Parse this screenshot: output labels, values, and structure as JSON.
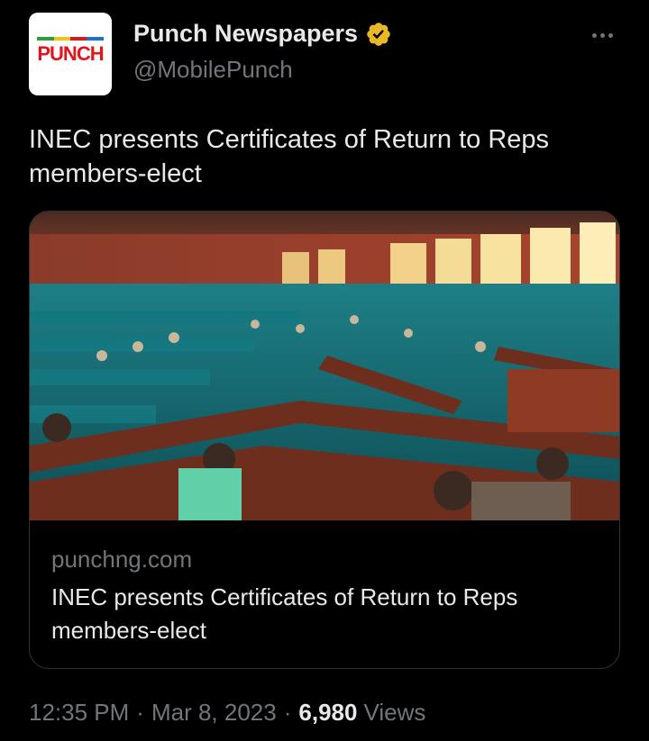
{
  "author": {
    "display_name": "Punch Newspapers",
    "handle": "@MobilePunch",
    "avatar_text": "PUNCH",
    "verified": true,
    "verified_color": "#e8b828"
  },
  "tweet": {
    "text": "INEC presents Certificates of Return to Reps members-elect"
  },
  "link_card": {
    "domain": "punchng.com",
    "title": "INEC presents Certificates of Return to Reps members-elect",
    "image_icon": "parliament-chamber-photo"
  },
  "meta": {
    "time": "12:35 PM",
    "separator": "·",
    "date": "Mar 8, 2023",
    "views_count": "6,980",
    "views_label": "Views"
  },
  "colors": {
    "background": "#000000",
    "primary_text": "#e7e9ea",
    "secondary_text": "#71767b",
    "border": "#2f3336",
    "brand_red": "#e0161b"
  }
}
